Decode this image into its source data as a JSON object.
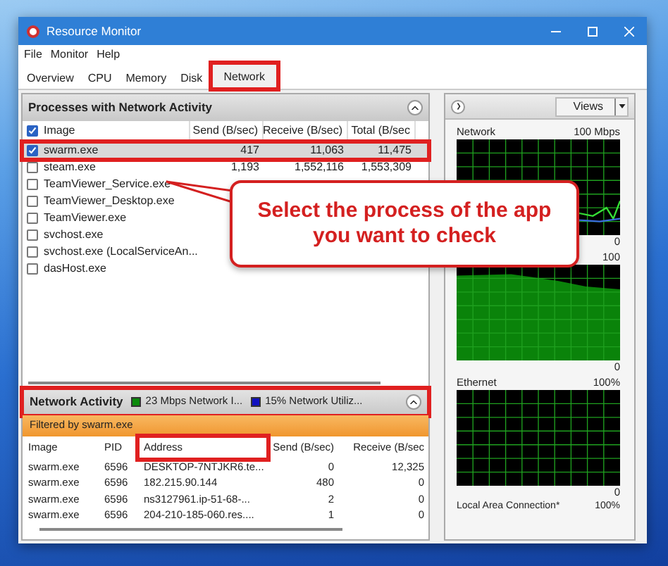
{
  "window": {
    "title": "Resource Monitor"
  },
  "menu": [
    "File",
    "Monitor",
    "Help"
  ],
  "tabs": [
    {
      "label": "Overview",
      "selected": false,
      "highlighted": false
    },
    {
      "label": "CPU",
      "selected": false,
      "highlighted": false
    },
    {
      "label": "Memory",
      "selected": false,
      "highlighted": false
    },
    {
      "label": "Disk",
      "selected": false,
      "highlighted": false
    },
    {
      "label": "Network",
      "selected": true,
      "highlighted": true
    }
  ],
  "processes": {
    "title": "Processes with Network Activity",
    "header_checked": true,
    "columns": [
      "Image",
      "Send (B/sec)",
      "Receive (B/sec)",
      "Total (B/sec"
    ],
    "rows": [
      {
        "image": "swarm.exe",
        "send": "417",
        "receive": "11,063",
        "total": "11,475",
        "checked": true,
        "selected": true,
        "highlighted": true
      },
      {
        "image": "steam.exe",
        "send": "1,193",
        "receive": "1,552,116",
        "total": "1,553,309",
        "checked": false,
        "selected": false,
        "highlighted": false
      },
      {
        "image": "TeamViewer_Service.exe",
        "checked": false,
        "selected": false,
        "highlighted": false
      },
      {
        "image": "TeamViewer_Desktop.exe",
        "checked": false,
        "selected": false,
        "highlighted": false
      },
      {
        "image": "TeamViewer.exe",
        "checked": false,
        "selected": false,
        "highlighted": false
      },
      {
        "image": "svchost.exe",
        "checked": false,
        "selected": false,
        "highlighted": false
      },
      {
        "image": "svchost.exe (LocalServiceAn...",
        "checked": false,
        "selected": false,
        "highlighted": false
      },
      {
        "image": "dasHost.exe",
        "checked": false,
        "selected": false,
        "highlighted": false
      }
    ]
  },
  "network_activity": {
    "title": "Network Activity",
    "highlighted": true,
    "legend": [
      {
        "label": "23 Mbps Network I...",
        "color": "#0a8a0a"
      },
      {
        "label": "15% Network Utiliz...",
        "color": "#1010c0"
      }
    ],
    "filter": "Filtered by swarm.exe",
    "columns": [
      {
        "label": "Image",
        "highlighted": false
      },
      {
        "label": "PID",
        "highlighted": false
      },
      {
        "label": "Address",
        "highlighted": true
      },
      {
        "label": "Send (B/sec)",
        "highlighted": false
      },
      {
        "label": "Receive (B/sec",
        "highlighted": false
      }
    ],
    "rows": [
      [
        "swarm.exe",
        "6596",
        "DESKTOP-7NTJKR6.te...",
        "0",
        "12,325"
      ],
      [
        "swarm.exe",
        "6596",
        "182.215.90.144",
        "480",
        "0"
      ],
      [
        "swarm.exe",
        "6596",
        "ns3127961.ip-51-68-...",
        "2",
        "0"
      ],
      [
        "swarm.exe",
        "6596",
        "204-210-185-060.res....",
        "1",
        "0"
      ]
    ]
  },
  "side_panel": {
    "views_button": "Views",
    "graphs": [
      {
        "kind": "line",
        "title": "Network",
        "max": "100 Mbps",
        "min": "0"
      },
      {
        "kind": "area",
        "max": "100",
        "min": "0"
      },
      {
        "kind": "empty",
        "title": "Ethernet",
        "max": "100%",
        "min": "0"
      }
    ],
    "next_graph": {
      "title": "Local Area Connection*",
      "max": "100%"
    }
  },
  "callout": {
    "text": "Select the process of the app you want to check"
  }
}
